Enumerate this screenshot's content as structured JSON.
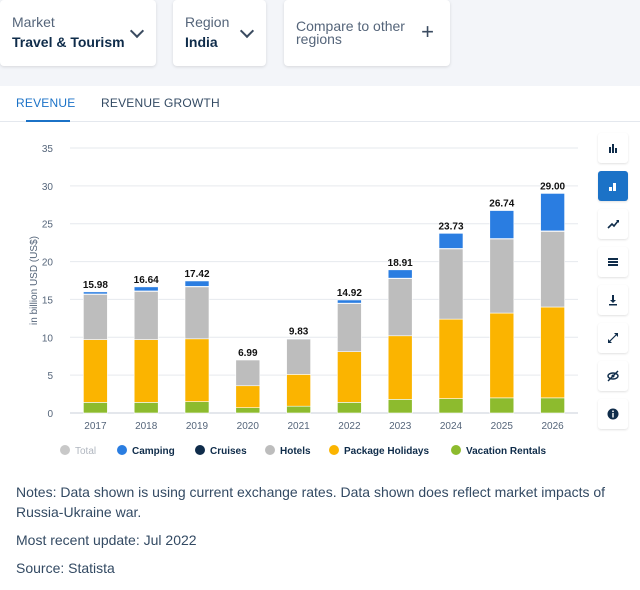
{
  "filters": {
    "market": {
      "label": "Market",
      "value": "Travel & Tourism"
    },
    "region": {
      "label": "Region",
      "value": "India"
    },
    "compare": {
      "label": "Compare to other regions"
    }
  },
  "tabs": [
    {
      "label": "REVENUE",
      "active": true
    },
    {
      "label": "REVENUE GROWTH",
      "active": false
    }
  ],
  "toolbar": {
    "icons": [
      "bar-chart-icon",
      "stacked-bar-icon",
      "trend-line-icon",
      "table-icon",
      "download-icon",
      "expand-icon",
      "hide-icon",
      "info-icon"
    ],
    "active_index": 1,
    "accent": "#1b72c7"
  },
  "chart_data": {
    "type": "bar",
    "stacked": true,
    "ylabel": "in billion USD (US$)",
    "ylim": [
      0,
      35
    ],
    "yticks": [
      0,
      5,
      10,
      15,
      20,
      25,
      30,
      35
    ],
    "grid": true,
    "legend_position": "bottom",
    "categories": [
      "2017",
      "2018",
      "2019",
      "2020",
      "2021",
      "2022",
      "2023",
      "2024",
      "2025",
      "2026"
    ],
    "totals": [
      "15.98",
      "16.64",
      "17.42",
      "6.99",
      "9.83",
      "14.92",
      "18.91",
      "23.73",
      "26.74",
      "29.00"
    ],
    "series": [
      {
        "name": "Vacation Rentals",
        "color": "#8dbb2e",
        "values": [
          1.4,
          1.4,
          1.5,
          0.7,
          0.9,
          1.4,
          1.8,
          1.9,
          2.0,
          2.0
        ]
      },
      {
        "name": "Package Holidays",
        "color": "#fbb400",
        "values": [
          8.3,
          8.3,
          8.3,
          2.9,
          4.2,
          6.7,
          8.4,
          10.5,
          11.2,
          12.0
        ]
      },
      {
        "name": "Hotels",
        "color": "#bdbdbd",
        "values": [
          6.0,
          6.4,
          6.9,
          3.4,
          4.7,
          6.4,
          7.6,
          9.3,
          9.8,
          10.0
        ]
      },
      {
        "name": "Cruises",
        "color": "#0f2c4a",
        "values": [
          0.02,
          0.02,
          0.02,
          0.0,
          0.0,
          0.01,
          0.01,
          0.03,
          0.04,
          0.05
        ]
      },
      {
        "name": "Camping",
        "color": "#2a7de1",
        "values": [
          0.28,
          0.54,
          0.72,
          0.0,
          0.03,
          0.42,
          1.1,
          2.0,
          3.7,
          4.95
        ]
      }
    ],
    "legend": [
      {
        "name": "Total",
        "color": "#c8c8c8",
        "muted": true
      },
      {
        "name": "Camping",
        "color": "#2a7de1"
      },
      {
        "name": "Cruises",
        "color": "#0f2c4a"
      },
      {
        "name": "Hotels",
        "color": "#bdbdbd"
      },
      {
        "name": "Package Holidays",
        "color": "#fbb400"
      },
      {
        "name": "Vacation Rentals",
        "color": "#8dbb2e"
      }
    ]
  },
  "notes": {
    "line1": "Notes: Data shown is using current exchange rates. Data shown does reflect market impacts of Russia-Ukraine war.",
    "line2": "Most recent update: Jul 2022",
    "line3": "Source: Statista"
  }
}
